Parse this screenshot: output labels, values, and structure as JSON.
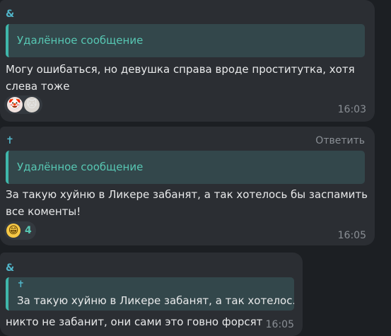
{
  "messages": [
    {
      "sender": "&",
      "quote": "Удалённое сообщение",
      "text_line1": "Могу ошибаться, но девушка справа вроде проститутка, хотя",
      "text_line2": "слева тоже",
      "reactions": {
        "avatars": [
          "clown-emoji",
          "cat-avatar"
        ],
        "clown_glyph": "🤡",
        "cat_glyph": "🐱"
      },
      "time": "16:03"
    },
    {
      "sender": "✝",
      "reply_label": "Ответить",
      "quote": "Удалённое сообщение",
      "text_line1": "За такую хуйню в Ликере забанят, а так хотелось бы заспамить",
      "text_line2": "все коменты!",
      "reactions": {
        "emoji": "grinning-face",
        "emoji_glyph": "😁",
        "count": "4"
      },
      "time": "16:05"
    },
    {
      "sender": "&",
      "quote_author": "✝",
      "quote": "За такую хуйню в Ликере забанят, а так хотелос...",
      "text_line1": "никто не забанит, они сами это говно форсят",
      "time": "16:05"
    }
  ],
  "colors": {
    "background": "#1c1f23",
    "bubble": "#2b2e33",
    "accent": "#51b5c9",
    "quote_text": "#57c7b3",
    "time": "#8a8f95"
  }
}
